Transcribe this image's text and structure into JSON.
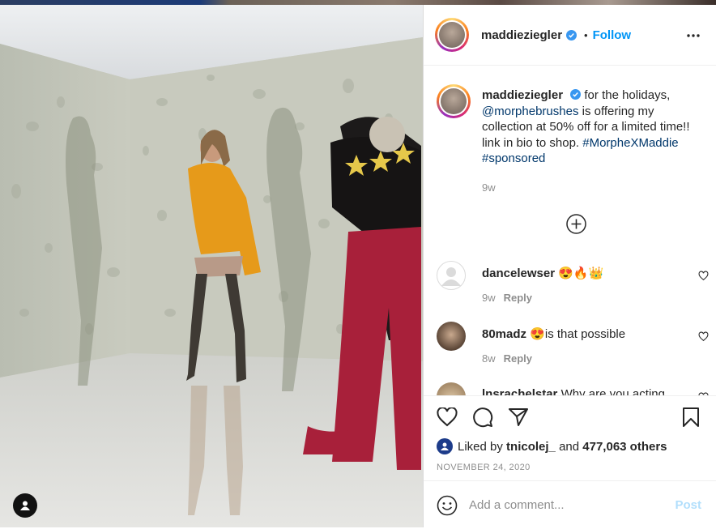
{
  "post": {
    "username": "maddieziegler",
    "follow_separator": "•",
    "follow_label": "Follow",
    "more_icon": "more-icon",
    "verified_icon": "verified-badge-icon"
  },
  "caption": {
    "username": "maddieziegler",
    "text_part1": "for the holidays,",
    "mention": "@morphebrushes",
    "text_part2": "is offering my collection at 50% off for a limited time!! link in bio to shop.",
    "hashtag1": "#MorpheXMaddie",
    "hashtag2": "#sponsored",
    "time": "9w"
  },
  "comments": [
    {
      "username": "dancelewser",
      "text": "😍🔥👑",
      "time": "9w",
      "reply_label": "Reply"
    },
    {
      "username": "80madz",
      "text": "😍is that possible",
      "time": "8w",
      "reply_label": "Reply"
    },
    {
      "username": "lnsrachelstar",
      "text": "Why are you acting",
      "time": "",
      "reply_label": ""
    }
  ],
  "actions": {
    "liked_by_prefix": "Liked by",
    "liked_by_user": "tnicolej_",
    "and_label": "and",
    "others_count": "477,063 others",
    "date": "NOVEMBER 24, 2020"
  },
  "add_comment": {
    "placeholder": "Add a comment...",
    "post_label": "Post"
  },
  "colors": {
    "accent": "#0095f6",
    "hashtag": "#00376b",
    "muted": "#8e8e8e",
    "post_disabled": "#b2dffc"
  }
}
